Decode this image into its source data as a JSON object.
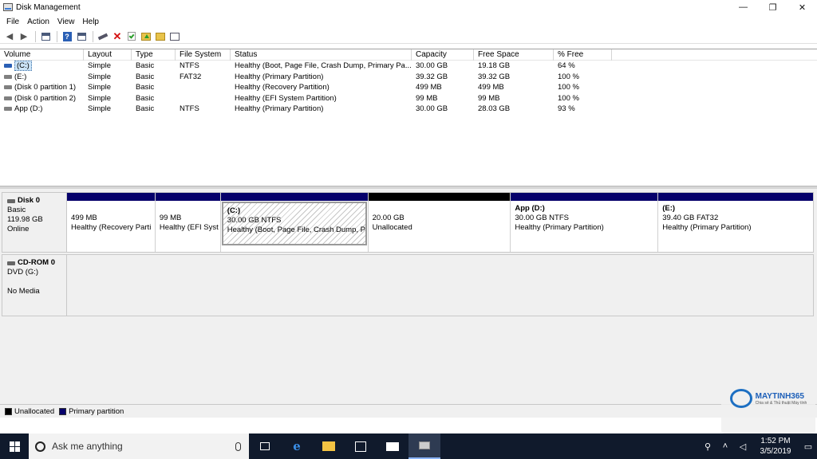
{
  "window": {
    "title": "Disk Management",
    "controls": {
      "minimize": "—",
      "maximize": "❐",
      "close": "✕"
    }
  },
  "menu": [
    "File",
    "Action",
    "View",
    "Help"
  ],
  "toolbar": {
    "icons": [
      "back-icon",
      "forward-icon",
      "properties-icon",
      "help-icon",
      "console-icon",
      "connect-icon",
      "delete-icon",
      "check-icon",
      "folder-up-icon",
      "folder-search-icon",
      "settings-list-icon"
    ],
    "delete_glyph": "✕",
    "back_glyph": "◀",
    "forward_glyph": "▶",
    "help_glyph": "?"
  },
  "volume_table": {
    "columns": [
      "Volume",
      "Layout",
      "Type",
      "File System",
      "Status",
      "Capacity",
      "Free Space",
      "% Free"
    ],
    "rows": [
      {
        "volume": "(C:)",
        "layout": "Simple",
        "type": "Basic",
        "fs": "NTFS",
        "status": "Healthy (Boot, Page File, Crash Dump, Primary Pa...",
        "capacity": "30.00 GB",
        "free": "19.18 GB",
        "pct": "64 %"
      },
      {
        "volume": "(E:)",
        "layout": "Simple",
        "type": "Basic",
        "fs": "FAT32",
        "status": "Healthy (Primary Partition)",
        "capacity": "39.32 GB",
        "free": "39.32 GB",
        "pct": "100 %"
      },
      {
        "volume": "(Disk 0 partition 1)",
        "layout": "Simple",
        "type": "Basic",
        "fs": "",
        "status": "Healthy (Recovery Partition)",
        "capacity": "499 MB",
        "free": "499 MB",
        "pct": "100 %"
      },
      {
        "volume": "(Disk 0 partition 2)",
        "layout": "Simple",
        "type": "Basic",
        "fs": "",
        "status": "Healthy (EFI System Partition)",
        "capacity": "99 MB",
        "free": "99 MB",
        "pct": "100 %"
      },
      {
        "volume": "App (D:)",
        "layout": "Simple",
        "type": "Basic",
        "fs": "NTFS",
        "status": "Healthy (Primary Partition)",
        "capacity": "30.00 GB",
        "free": "28.03 GB",
        "pct": "93 %"
      }
    ]
  },
  "disk0": {
    "name": "Disk 0",
    "type": "Basic",
    "size": "119.98 GB",
    "state": "Online",
    "partitions": [
      {
        "name": "",
        "size": "499 MB",
        "status": "Healthy (Recovery Parti"
      },
      {
        "name": "",
        "size": "99 MB",
        "status": "Healthy (EFI Syst"
      },
      {
        "name": "(C:)",
        "size": "30.00 GB NTFS",
        "status": "Healthy (Boot, Page File, Crash Dump, Pr"
      },
      {
        "name": "",
        "size": "20.00 GB",
        "status": "Unallocated"
      },
      {
        "name": "App  (D:)",
        "size": "30.00 GB NTFS",
        "status": "Healthy (Primary Partition)"
      },
      {
        "name": "(E:)",
        "size": "39.40 GB FAT32",
        "status": "Healthy (Primary Partition)"
      }
    ]
  },
  "cdrom0": {
    "name": "CD-ROM 0",
    "drive": "DVD (G:)",
    "media": "No Media"
  },
  "legend": [
    {
      "label": "Unallocated",
      "color": "#000000"
    },
    {
      "label": "Primary partition",
      "color": "#06006b"
    }
  ],
  "watermark": {
    "brand": "MAYTINH365",
    "tagline": "Chia sẻ & Thủ thuật Máy tính"
  },
  "taskbar": {
    "search_placeholder": "Ask me anything",
    "clock_time": "1:52 PM",
    "clock_date": "3/5/2019"
  }
}
